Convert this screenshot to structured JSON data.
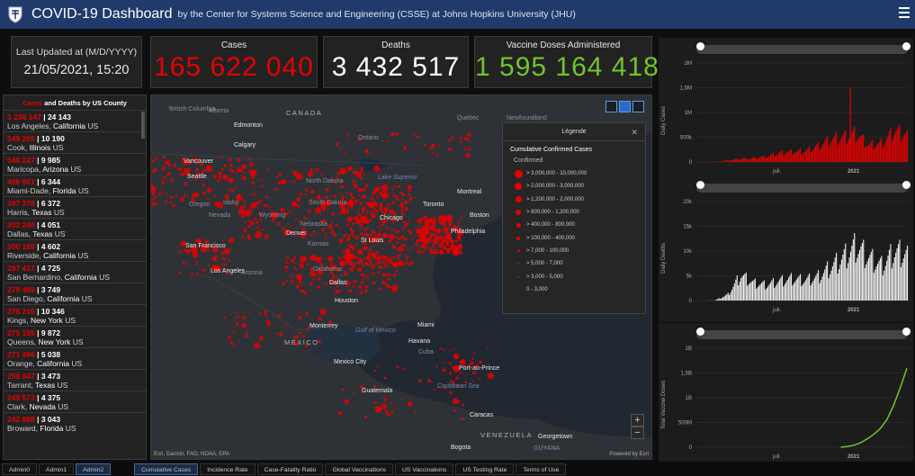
{
  "header": {
    "title": "COVID-19 Dashboard",
    "subtitle": "by the Center for Systems Science and Engineering (CSSE) at Johns Hopkins University (JHU)"
  },
  "updated": {
    "label": "Last Updated at (M/D/YYYY)",
    "value": "21/05/2021, 15:20"
  },
  "stats": {
    "cases": {
      "label": "Cases",
      "value": "165 622 040",
      "color": "#e60000"
    },
    "deaths": {
      "label": "Deaths",
      "value": "3 432 517",
      "color": "#ffffff"
    },
    "vaccines": {
      "label": "Vaccine Doses Administered",
      "value": "1 595 164 418",
      "color": "#70c52a"
    }
  },
  "counties": {
    "heading_red": "Cases",
    "heading_rest": " and Deaths by US County",
    "items": [
      {
        "cases": "1 238 147",
        "deaths": "24 143",
        "name": "Los Angeles, ",
        "state": "California",
        "country": " US"
      },
      {
        "cases": "549 205",
        "deaths": "10 190",
        "name": "Cook, ",
        "state": "Illinois",
        "country": " US"
      },
      {
        "cases": "546 247",
        "deaths": "9 985",
        "name": "Maricopa, ",
        "state": "Arizona",
        "country": " US"
      },
      {
        "cases": "496 961",
        "deaths": "6 344",
        "name": "Miami-Dade, ",
        "state": "Florida",
        "country": " US"
      },
      {
        "cases": "397 378",
        "deaths": "6 372",
        "name": "Harris, ",
        "state": "Texas",
        "country": " US"
      },
      {
        "cases": "302 240",
        "deaths": "4 051",
        "name": "Dallas, ",
        "state": "Texas",
        "country": " US"
      },
      {
        "cases": "300 189",
        "deaths": "4 602",
        "name": "Riverside, ",
        "state": "California",
        "country": " US"
      },
      {
        "cases": "297 417",
        "deaths": "4 725",
        "name": "San Bernardino, ",
        "state": "California",
        "country": " US"
      },
      {
        "cases": "279 489",
        "deaths": "3 749",
        "name": "San Diego, ",
        "state": "California",
        "country": " US"
      },
      {
        "cases": "278 210",
        "deaths": "10 346",
        "name": "Kings, ",
        "state": "New York",
        "country": " US"
      },
      {
        "cases": "275 195",
        "deaths": "9 872",
        "name": "Queens, ",
        "state": "New York",
        "country": " US"
      },
      {
        "cases": "271 496",
        "deaths": "5 038",
        "name": "Orange, ",
        "state": "California",
        "country": " US"
      },
      {
        "cases": "259 847",
        "deaths": "3 473",
        "name": "Tarrant, ",
        "state": "Texas",
        "country": " US"
      },
      {
        "cases": "249 573",
        "deaths": "4 375",
        "name": "Clark, ",
        "state": "Nevada",
        "country": " US"
      },
      {
        "cases": "242 888",
        "deaths": "3 043",
        "name": "Broward, ",
        "state": "Florida",
        "country": " US"
      }
    ]
  },
  "map": {
    "attribution": "Esri, Garmin, FAO, NOAA, EPA",
    "powered": "Powered by Esri",
    "zoom_in": "+",
    "zoom_out": "−",
    "labels": {
      "canada": "CANADA",
      "mexico": "MÉXICO",
      "british_columbia": "British Columbia",
      "alberta": "Alberta",
      "ontario": "Ontario",
      "quebec": "Quebec",
      "newfoundland": "Newfoundland",
      "edmonton": "Edmonton",
      "calgary": "Calgary",
      "vancouver": "Vancouver",
      "seattle": "Seattle",
      "oregon": "Oregon",
      "idaho": "Idaho",
      "wyoming": "Wyoming",
      "north_dakota": "North Dakota",
      "south_dakota": "South Dakota",
      "nebraska": "Nebraska",
      "nevada": "Nevada",
      "denver": "Denver",
      "kansas": "Kansas",
      "san_francisco": "San Francisco",
      "los_angeles": "Los Angeles",
      "arizona": "Arizona",
      "oklahoma": "Oklahoma",
      "dallas": "Dallas",
      "houston": "Houston",
      "chicago": "Chicago",
      "st_louis": "St Louis",
      "toronto": "Toronto",
      "montreal": "Montreal",
      "boston": "Boston",
      "philadelphia": "Philadelphia",
      "lake_superior": "Lake Superior",
      "monterrey": "Monterrey",
      "gulf": "Gulf of Mexico",
      "miami": "Miami",
      "havana": "Havana",
      "cuba": "Cuba",
      "mexico_city": "Mexico City",
      "guatemala": "Guatemala",
      "port_au_prince": "Port-au-Prince",
      "caribbean": "Caribbean Sea",
      "caracas": "Caracas",
      "bogota": "Bogota",
      "venezuela": "VENEZUELA",
      "georgetown": "Georgetown",
      "guyana": "GUYANA"
    }
  },
  "legend": {
    "header": "Légende",
    "close": "✕",
    "title": "Cumulative Confirmed Cases",
    "subtitle": "Confirmed",
    "rows": [
      "> 3,000,000 - 10,000,000",
      "> 2,000,000 - 3,000,000",
      "> 1,200,000 - 2,000,000",
      "> 800,000 - 1,200,000",
      "> 400,000 - 800,000",
      "> 100,000 - 400,000",
      "> 7,000 - 100,000",
      "> 5,000 - 7,000",
      "> 3,000 - 5,000",
      "0 - 3,000"
    ]
  },
  "chart_data": [
    {
      "type": "bar",
      "ylabel": "Daily Cases",
      "color": "#e60000",
      "yticks": [
        "2M",
        "1,5M",
        "1M",
        "500k",
        "0"
      ],
      "ylim": [
        0,
        2000000
      ],
      "xticks": [
        "juil.",
        "2021"
      ],
      "x": [
        "2020-01",
        "2020-02",
        "2020-03",
        "2020-04",
        "2020-05",
        "2020-06",
        "2020-07",
        "2020-08",
        "2020-09",
        "2020-10",
        "2020-11",
        "2020-12",
        "2021-01",
        "2021-02",
        "2021-03",
        "2021-04",
        "2021-05"
      ],
      "values": [
        0,
        2000,
        40000,
        80000,
        95000,
        140000,
        230000,
        260000,
        280000,
        400000,
        580000,
        640000,
        720000,
        440000,
        480000,
        800000,
        700000
      ],
      "spike": {
        "x": "2020-12",
        "value": 1500000
      }
    },
    {
      "type": "bar",
      "ylabel": "Daily Deaths",
      "color": "#f2f2f2",
      "yticks": [
        "20k",
        "15k",
        "10k",
        "5k",
        "0"
      ],
      "ylim": [
        0,
        20000
      ],
      "xticks": [
        "juil.",
        "2021"
      ],
      "x": [
        "2020-01",
        "2020-02",
        "2020-03",
        "2020-04",
        "2020-05",
        "2020-06",
        "2020-07",
        "2020-08",
        "2020-09",
        "2020-10",
        "2020-11",
        "2020-12",
        "2021-01",
        "2021-02",
        "2021-03",
        "2021-04",
        "2021-05"
      ],
      "values": [
        0,
        50,
        1500,
        6500,
        4500,
        4000,
        5000,
        5600,
        5200,
        6000,
        8500,
        11000,
        14000,
        11000,
        9000,
        12500,
        12000
      ]
    },
    {
      "type": "line",
      "ylabel": "Total Vaccine Doses",
      "color": "#70c52a",
      "yticks": [
        "2B",
        "1,5B",
        "1B",
        "500M",
        "0"
      ],
      "ylim": [
        0,
        2000000000
      ],
      "xticks": [
        "juil.",
        "2021"
      ],
      "x": [
        "2020-12-15",
        "2021-01-01",
        "2021-01-15",
        "2021-02-01",
        "2021-02-15",
        "2021-03-01",
        "2021-03-15",
        "2021-04-01",
        "2021-04-15",
        "2021-05-01",
        "2021-05-21"
      ],
      "values": [
        0,
        15000000,
        40000000,
        90000000,
        170000000,
        260000000,
        380000000,
        560000000,
        850000000,
        1200000000,
        1595164418
      ]
    }
  ],
  "tabs": {
    "admin": [
      "Admin0",
      "Admin1",
      "Admin2"
    ],
    "views": [
      "Cumulative Cases",
      "Incidence Rate",
      "Case-Fatality Ratio",
      "Global Vaccinations",
      "US Vaccinations",
      "US Testing Rate",
      "Terms of Use"
    ]
  }
}
